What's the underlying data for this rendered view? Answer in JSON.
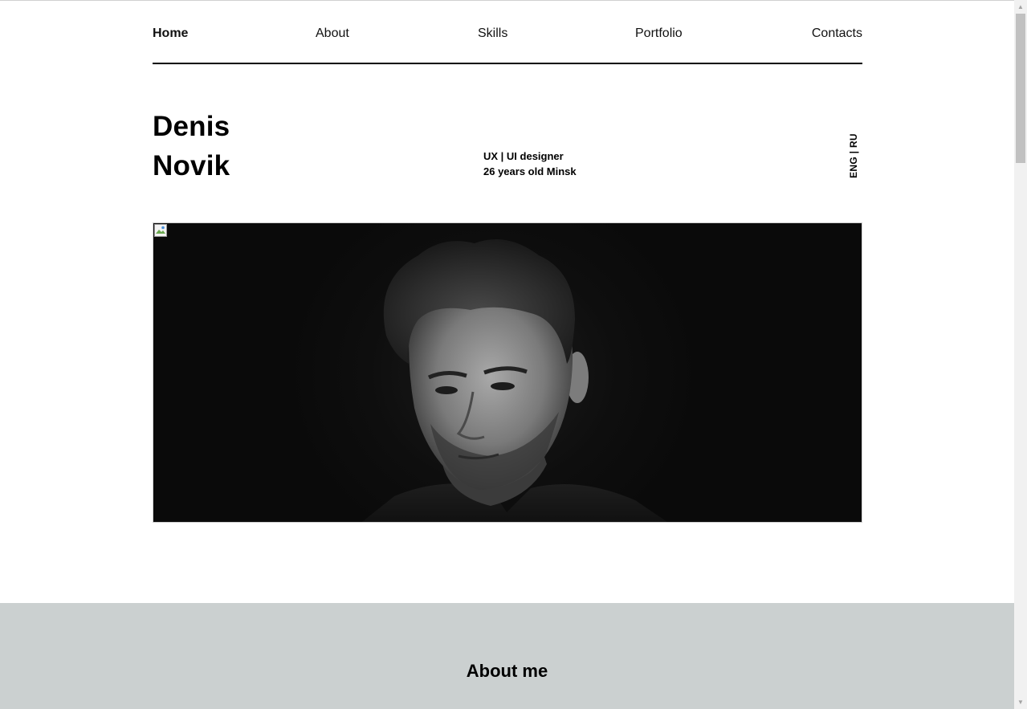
{
  "nav": {
    "items": [
      {
        "label": "Home",
        "active": true
      },
      {
        "label": "About",
        "active": false
      },
      {
        "label": "Skills",
        "active": false
      },
      {
        "label": "Portfolio",
        "active": false
      },
      {
        "label": "Contacts",
        "active": false
      }
    ]
  },
  "hero": {
    "first_name": "Denis",
    "last_name": "Novik",
    "role": "UX | UI designer",
    "info": "26 years old Minsk"
  },
  "lang": {
    "eng": "ENG",
    "separator": " | ",
    "ru": "RU"
  },
  "about": {
    "title": "About me"
  },
  "colors": {
    "about_bg": "#cbd0d0",
    "photo_bg": "#0b0b0b",
    "text": "#000000"
  }
}
